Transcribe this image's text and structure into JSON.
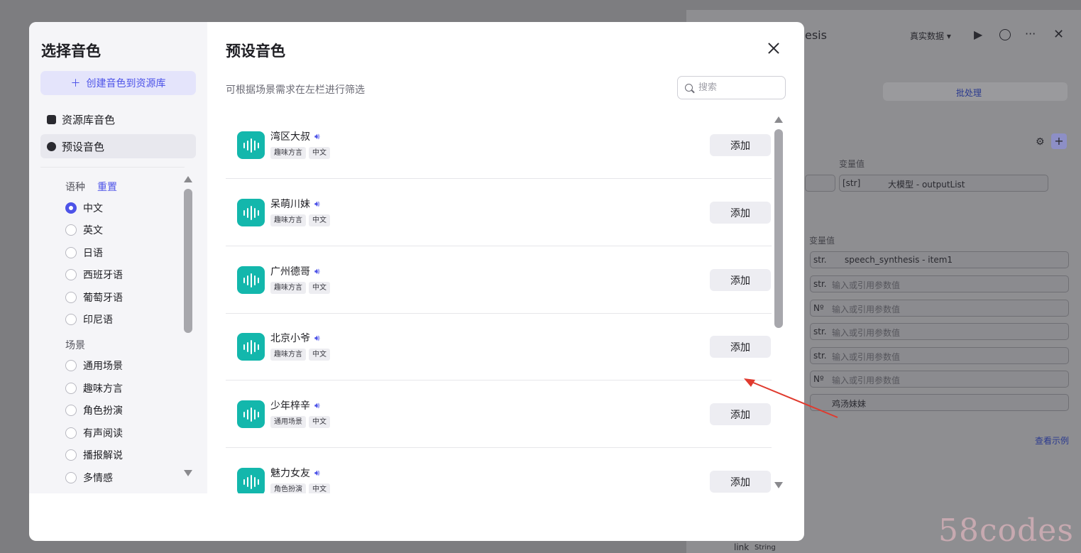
{
  "background": {
    "header": {
      "title_fragment": "esis",
      "real_data": "真实数据 ▾"
    },
    "tab_batch": "批处理",
    "var_value_header_1": "变量值",
    "var_value_header_2": "变量值",
    "output_field": {
      "type": "[str]",
      "source": "大模型 - outputList"
    },
    "inputs": [
      {
        "type": "str.",
        "value": "speech_synthesis - item1"
      },
      {
        "type": "str.",
        "placeholder": "输入或引用参数值"
      },
      {
        "type": "Nº",
        "placeholder": "输入或引用参数值"
      },
      {
        "type": "str.",
        "placeholder": "输入或引用参数值"
      },
      {
        "type": "str.",
        "placeholder": "输入或引用参数值"
      },
      {
        "type": "Nº",
        "placeholder": "输入或引用参数值"
      },
      {
        "type": "",
        "value": "鸡汤妹妹"
      }
    ],
    "see_example": "查看示例",
    "link_label": "link",
    "link_type": "String",
    "watermark": "58codes"
  },
  "modal": {
    "left": {
      "title": "选择音色",
      "create_button": "创建音色到资源库",
      "nav": [
        {
          "label": "资源库音色",
          "active": false
        },
        {
          "label": "预设音色",
          "active": true
        }
      ],
      "language_label": "语种",
      "reset": "重置",
      "languages": [
        {
          "label": "中文",
          "checked": true
        },
        {
          "label": "英文",
          "checked": false
        },
        {
          "label": "日语",
          "checked": false
        },
        {
          "label": "西班牙语",
          "checked": false
        },
        {
          "label": "葡萄牙语",
          "checked": false
        },
        {
          "label": "印尼语",
          "checked": false
        }
      ],
      "scene_label": "场景",
      "scenes": [
        {
          "label": "通用场景"
        },
        {
          "label": "趣味方言"
        },
        {
          "label": "角色扮演"
        },
        {
          "label": "有声阅读"
        },
        {
          "label": "播报解说"
        },
        {
          "label": "多情感"
        }
      ]
    },
    "right": {
      "title": "预设音色",
      "hint": "可根据场景需求在左栏进行筛选",
      "search_placeholder": "搜索",
      "add_label": "添加",
      "voices": [
        {
          "name": "湾区大叔",
          "tags": [
            "趣味方言",
            "中文"
          ]
        },
        {
          "name": "呆萌川妹",
          "tags": [
            "趣味方言",
            "中文"
          ]
        },
        {
          "name": "广州德哥",
          "tags": [
            "趣味方言",
            "中文"
          ]
        },
        {
          "name": "北京小爷",
          "tags": [
            "趣味方言",
            "中文"
          ]
        },
        {
          "name": "少年梓辛",
          "tags": [
            "通用场景",
            "中文"
          ]
        },
        {
          "name": "魅力女友",
          "tags": [
            "角色扮演",
            "中文"
          ]
        }
      ]
    }
  }
}
